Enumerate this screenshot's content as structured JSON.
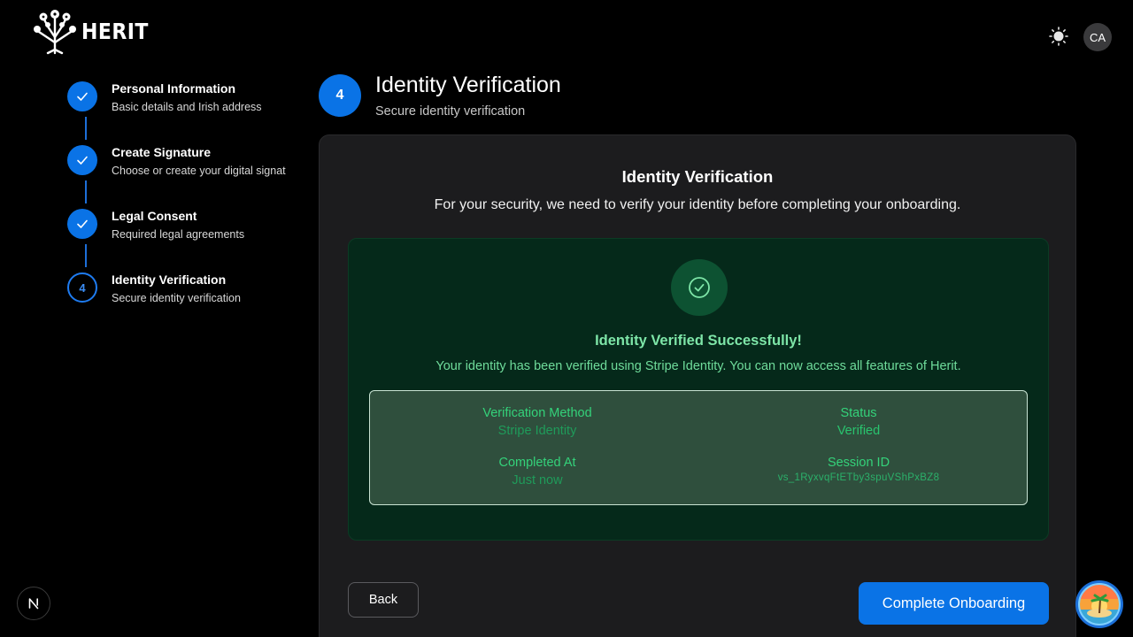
{
  "brand": {
    "name": "HERIT"
  },
  "header": {
    "avatar_initials": "CA",
    "theme_icon": "sun-icon"
  },
  "steps": [
    {
      "title": "Personal Information",
      "subtitle": "Basic details and Irish address",
      "state": "done"
    },
    {
      "title": "Create Signature",
      "subtitle": "Choose or create your digital signat",
      "state": "done"
    },
    {
      "title": "Legal Consent",
      "subtitle": "Required legal agreements",
      "state": "done"
    },
    {
      "title": "Identity Verification",
      "subtitle": "Secure identity verification",
      "state": "current",
      "number": "4"
    }
  ],
  "page": {
    "step_number": "4",
    "title": "Identity Verification",
    "subtitle": "Secure identity verification"
  },
  "card": {
    "title": "Identity Verification",
    "description": "For your security, we need to verify your identity before completing your onboarding.",
    "success": {
      "title": "Identity Verified Successfully!",
      "text": "Your identity has been verified using Stripe Identity. You can now access all features of Herit."
    },
    "details": {
      "method_label": "Verification Method",
      "method_value": "Stripe Identity",
      "status_label": "Status",
      "status_value": "Verified",
      "completed_label": "Completed At",
      "completed_value": "Just now",
      "session_label": "Session ID",
      "session_value": "vs_1RyxvqFtETby3spuVShPxBZ8"
    },
    "back_label": "Back",
    "complete_label": "Complete Onboarding"
  },
  "colors": {
    "accent": "#0a73e6",
    "success": "#34d27a",
    "success_bg": "#05291a"
  }
}
